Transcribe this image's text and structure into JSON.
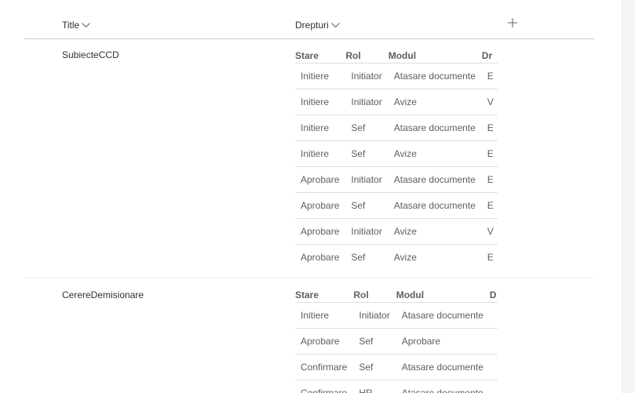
{
  "header": {
    "title_col": "Title",
    "drepturi_col": "Drepturi"
  },
  "rows": [
    {
      "title": "SubiecteCCD",
      "drepturi": {
        "headers": [
          "Stare",
          "Rol",
          "Modul",
          "Dr"
        ],
        "rows": [
          [
            "Initiere",
            "Initiator",
            "Atasare documente",
            "E"
          ],
          [
            "Initiere",
            "Initiator",
            "Avize",
            "V"
          ],
          [
            "Initiere",
            "Sef",
            "Atasare documente",
            "E"
          ],
          [
            "Initiere",
            "Sef",
            "Avize",
            "E"
          ],
          [
            "Aprobare",
            "Initiator",
            "Atasare documente",
            "E"
          ],
          [
            "Aprobare",
            "Sef",
            "Atasare documente",
            "E"
          ],
          [
            "Aprobare",
            "Initiator",
            "Avize",
            "V"
          ],
          [
            "Aprobare",
            "Sef",
            "Avize",
            "E"
          ]
        ]
      }
    },
    {
      "title": "CerereDemisionare",
      "drepturi": {
        "headers": [
          "Stare",
          "Rol",
          "Modul",
          "D"
        ],
        "rows": [
          [
            "Initiere",
            "Initiator",
            "Atasare documente",
            ""
          ],
          [
            "Aprobare",
            "Sef",
            "Aprobare",
            ""
          ],
          [
            "Confirmare",
            "Sef",
            "Atasare documente",
            ""
          ],
          [
            "Confirmare",
            "HR",
            "Atasare documente",
            ""
          ]
        ]
      }
    }
  ]
}
